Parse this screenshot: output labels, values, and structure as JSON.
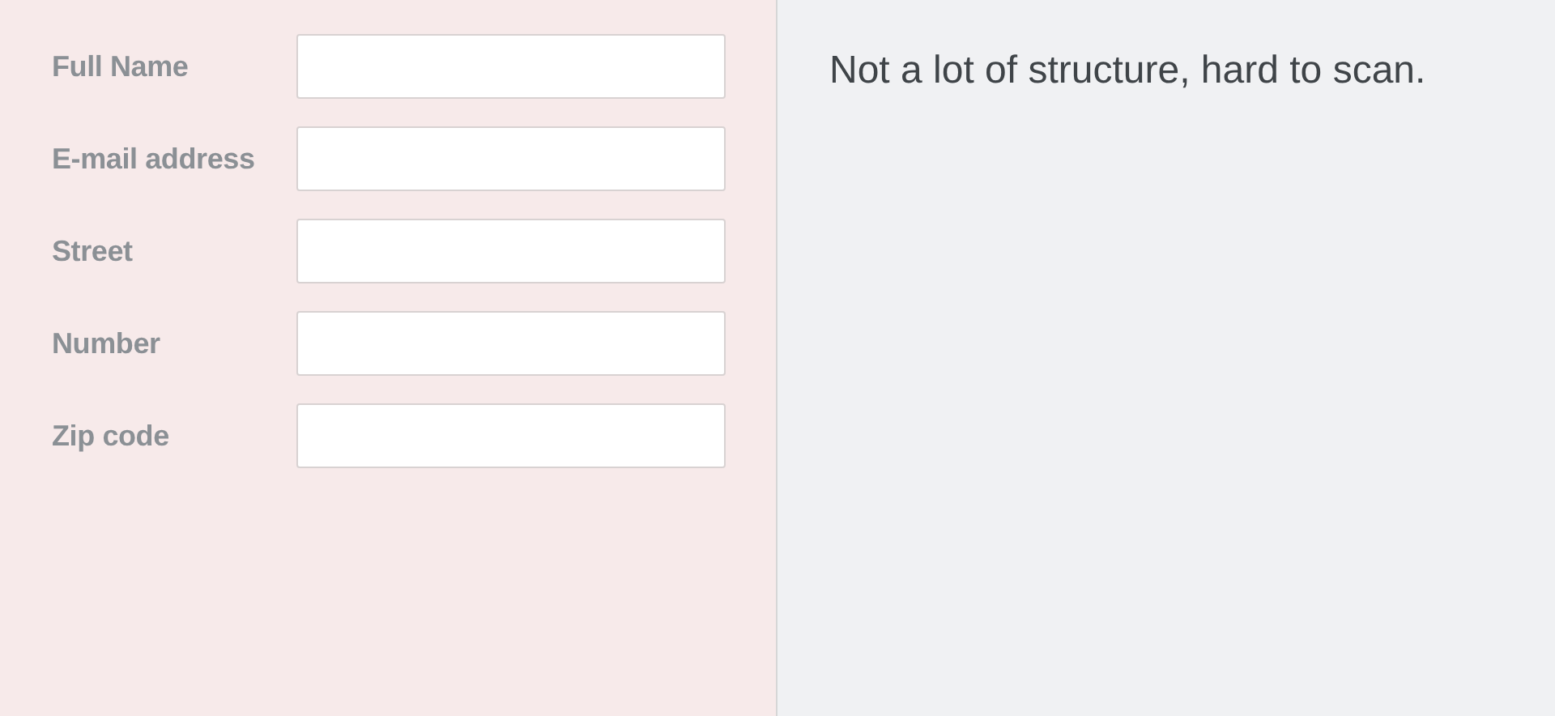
{
  "form": {
    "fields": [
      {
        "label": "Full Name"
      },
      {
        "label": "E-mail address"
      },
      {
        "label": "Street"
      },
      {
        "label": "Number"
      },
      {
        "label": "Zip code"
      }
    ]
  },
  "note": {
    "text": "Not a lot of structure, hard to scan."
  }
}
